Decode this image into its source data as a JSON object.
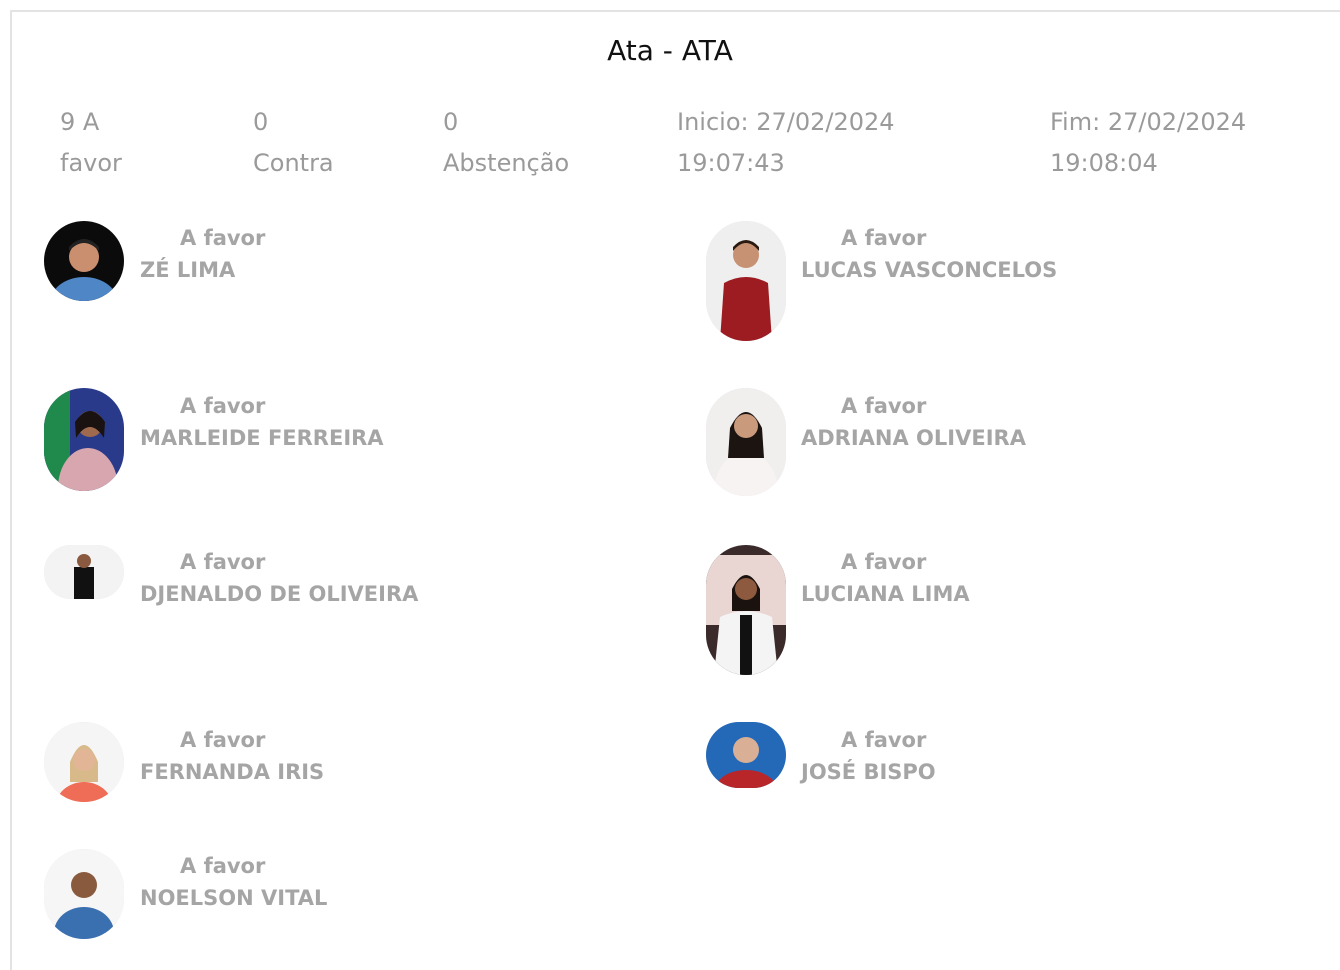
{
  "header": {
    "title": "Ata - ATA"
  },
  "summary": {
    "favor_line1": "9 A",
    "favor_line2": "favor",
    "contra_line1": "0",
    "contra_line2": "Contra",
    "abstencao_line1": "0",
    "abstencao_line2": "Abstenção",
    "inicio_line1": "Inicio: 27/02/2024",
    "inicio_line2": "19:07:43",
    "fim_line1": "Fim: 27/02/2024",
    "fim_line2": "19:08:04"
  },
  "votes": [
    {
      "vote": "A favor",
      "name": "ZÉ LIMA",
      "photo_bg": "#0b0b0b",
      "shirt": "#4f86c6"
    },
    {
      "vote": "A favor",
      "name": "LUCAS VASCONCELOS",
      "photo_bg": "#efefef",
      "shirt": "#9c1c22"
    },
    {
      "vote": "A favor",
      "name": "MARLEIDE FERREIRA",
      "photo_bg": "#2a3a8a",
      "shirt": "#d8a6ae"
    },
    {
      "vote": "A favor",
      "name": "ADRIANA OLIVEIRA",
      "photo_bg": "#f1eeee",
      "shirt": "#f6f3f2"
    },
    {
      "vote": "A favor",
      "name": "DJENALDO DE OLIVEIRA",
      "photo_bg": "#f3f3f3",
      "shirt": "#111111"
    },
    {
      "vote": "A favor",
      "name": "LUCIANA LIMA",
      "photo_bg": "#3a2a2a",
      "shirt": "#f4f4f4"
    },
    {
      "vote": "A favor",
      "name": "FERNANDA IRIS",
      "photo_bg": "#f5f5f5",
      "shirt": "#ef6c56"
    },
    {
      "vote": "A favor",
      "name": "JOSÉ BISPO",
      "photo_bg": "#2468b8",
      "shirt": "#b8262a"
    },
    {
      "vote": "A favor",
      "name": "NOELSON VITAL",
      "photo_bg": "#f6f6f6",
      "shirt": "#3a6fb0"
    }
  ]
}
